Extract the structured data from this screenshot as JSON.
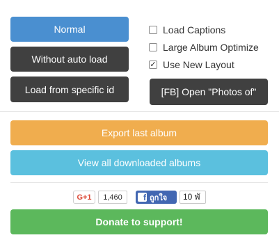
{
  "buttons": {
    "normal": "Normal",
    "without_auto_load": "Without auto load",
    "load_from_specific_id": "Load from specific id",
    "open_photos_of": "[FB] Open \"Photos of\"",
    "export_last_album": "Export last album",
    "view_all_downloaded": "View all downloaded albums",
    "donate": "Donate to support!"
  },
  "options": [
    {
      "label": "Load Captions",
      "checked": false
    },
    {
      "label": "Large Album Optimize",
      "checked": false
    },
    {
      "label": "Use New Layout",
      "checked": true
    }
  ],
  "social": {
    "gplus_label": "G+1",
    "gplus_count": "1,460",
    "fb_icon": "f",
    "fb_like_label": "ถูกใจ",
    "fb_count": "10 พั"
  },
  "colors": {
    "primary": "#4a8fd0",
    "dark": "#404040",
    "warning": "#f0ad4e",
    "info": "#5bc0de",
    "success": "#5cb85c",
    "facebook": "#4267b2",
    "gplus": "#dd4b39"
  }
}
